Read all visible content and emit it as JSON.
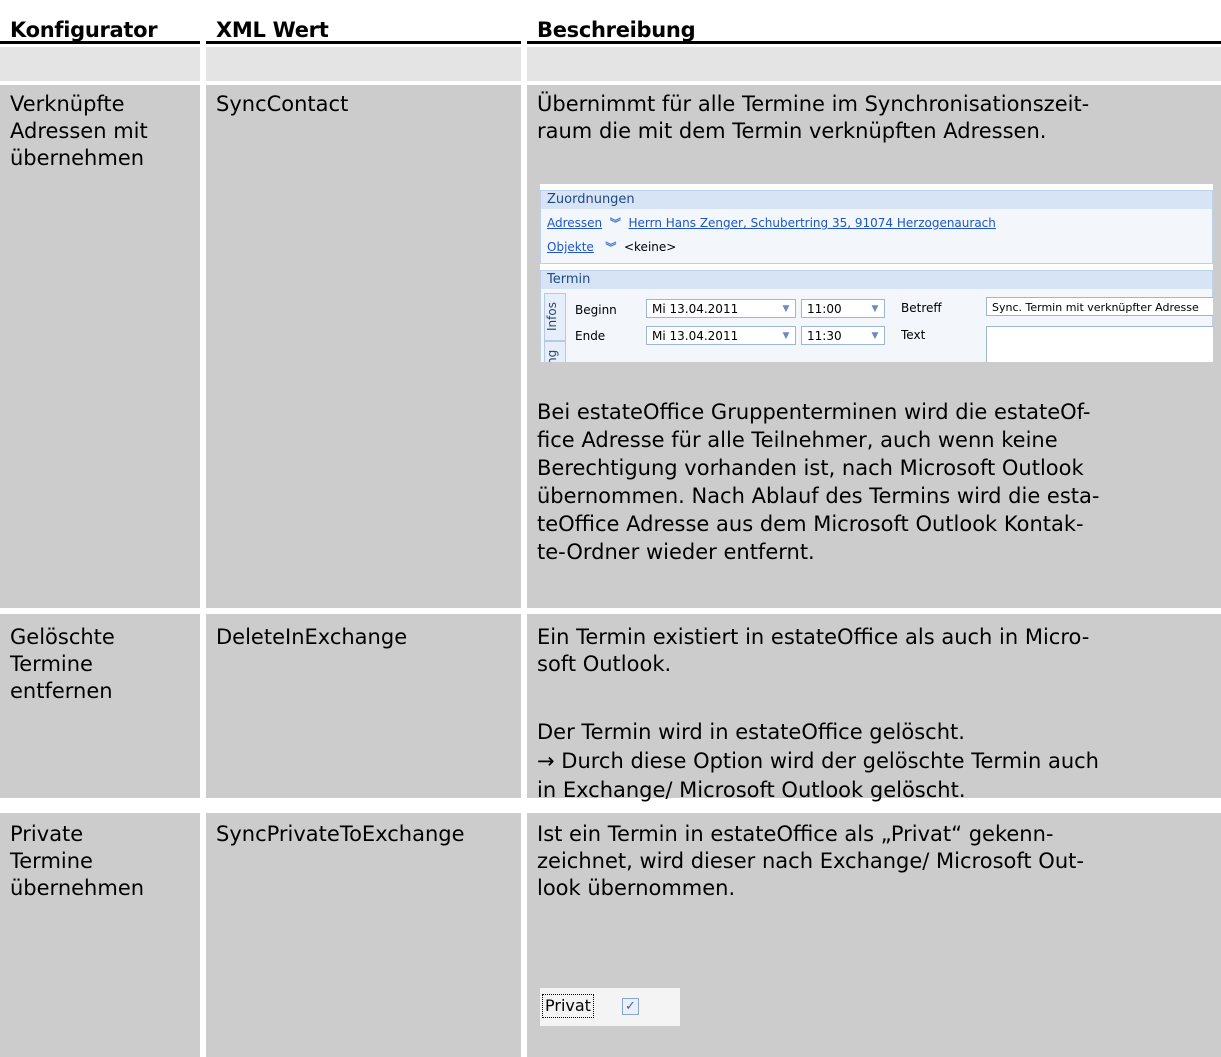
{
  "header": {
    "col1": "Konfigurator",
    "col2": "XML Wert",
    "col3": "Beschreibung"
  },
  "rows": [
    {
      "konfigurator": [
        "Verknüpfte",
        "Adressen mit",
        "übernehmen"
      ],
      "xml": "SyncContact",
      "desc1": [
        "Übernimmt für alle Termine im Synchronisationszeit-",
        "raum die mit dem Termin verknüpften Adressen."
      ],
      "desc2": [
        "Bei estateOffice Gruppenterminen wird die estateOf-",
        "fice Adresse für alle Teilnehmer, auch wenn keine",
        "Berechtigung vorhanden ist, nach Microsoft Outlook",
        "übernommen. Nach Ablauf des Termins wird die esta-",
        "teOffice Adresse aus dem Microsoft Outlook Kontak-",
        "te-Ordner wieder entfernt."
      ]
    },
    {
      "konfigurator": [
        "Gelöschte",
        "Termine",
        "entfernen"
      ],
      "xml": "DeleteInExchange",
      "desc1": [
        "Ein Termin existiert in estateOffice als auch in Micro-",
        "soft Outlook."
      ],
      "desc2": [
        "Der Termin wird in estateOffice gelöscht.",
        "→ Durch diese Option wird der gelöschte Termin auch",
        "in Exchange/ Microsoft Outlook gelöscht."
      ]
    },
    {
      "konfigurator": [
        "Private",
        "Termine",
        "übernehmen"
      ],
      "xml": "SyncPrivateToExchange",
      "desc1": [
        "Ist ein Termin in estateOffice als „Privat“ gekenn-",
        "zeichnet, wird dieser nach Exchange/ Microsoft Out-",
        "look übernommen."
      ]
    }
  ],
  "form": {
    "zuordnungen_title": "Zuordnungen",
    "adressen_label": "Adressen",
    "adressen_value": "Herrn Hans Zenger, Schubertring 35, 91074 Herzogenaurach",
    "objekte_label": "Objekte",
    "objekte_value": "<keine>",
    "termin_title": "Termin",
    "tab_infos": "Infos",
    "tab_second": "ng",
    "beginn_label": "Beginn",
    "ende_label": "Ende",
    "beginn_date": "Mi 13.04.2011",
    "beginn_time": "11:00",
    "ende_date": "Mi 13.04.2011",
    "ende_time": "11:30",
    "betreff_label": "Betreff",
    "betreff_value": "Sync. Termin mit verknüpfter Adresse",
    "text_label": "Text"
  },
  "privat": {
    "label": "Privat",
    "checked_glyph": "✓"
  },
  "icons": {
    "double_chevron": "double-chevron-down-icon",
    "dropdown": "dropdown-arrow-icon",
    "checkbox": "checkbox-checked-icon"
  }
}
